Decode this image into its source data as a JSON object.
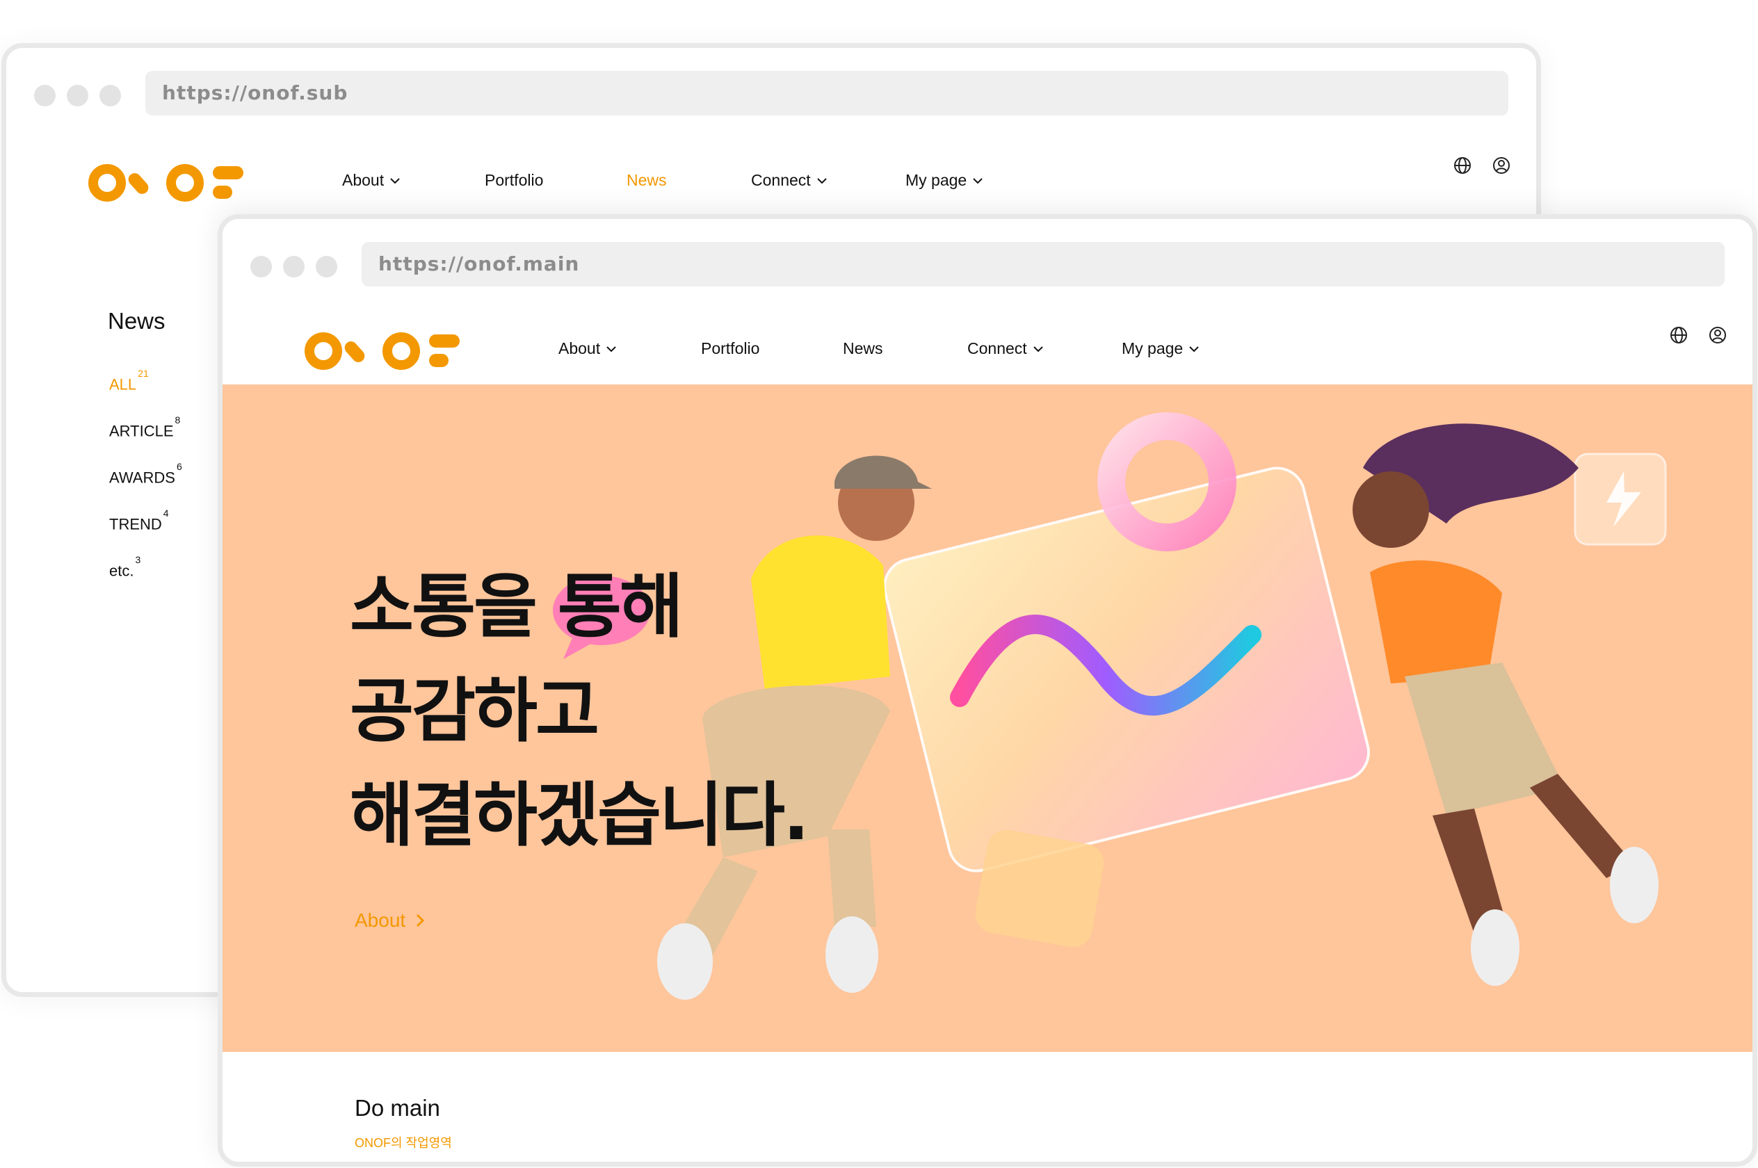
{
  "colors": {
    "accent": "#f39800",
    "hero_bg": "#ffc59b",
    "chrome": "#e8e8e8"
  },
  "brand": {
    "logo_text": "ONOF"
  },
  "back_window": {
    "url": "https://onof.sub",
    "nav": [
      "About",
      "Portfolio",
      "News",
      "Connect",
      "My page"
    ],
    "active_nav": "News",
    "sidebar": {
      "title": "News",
      "items": [
        {
          "label": "ALL",
          "count": "21"
        },
        {
          "label": "ARTICLE",
          "count": "8"
        },
        {
          "label": "AWARDS",
          "count": "6"
        },
        {
          "label": "TREND",
          "count": "4"
        },
        {
          "label": "etc.",
          "count": "3"
        }
      ]
    }
  },
  "front_window": {
    "url": "https://onof.main",
    "nav": [
      "About",
      "Portfolio",
      "News",
      "Connect",
      "My page"
    ],
    "hero": {
      "lines": [
        "소통을 통해",
        "공감하고",
        "해결하겠습니다."
      ],
      "link": "About"
    },
    "section": {
      "title": "Do main",
      "subtitle": "ONOF의 작업영역"
    }
  },
  "icons": [
    "globe-icon",
    "user-icon",
    "chevron-down-icon",
    "chevron-right-icon"
  ]
}
